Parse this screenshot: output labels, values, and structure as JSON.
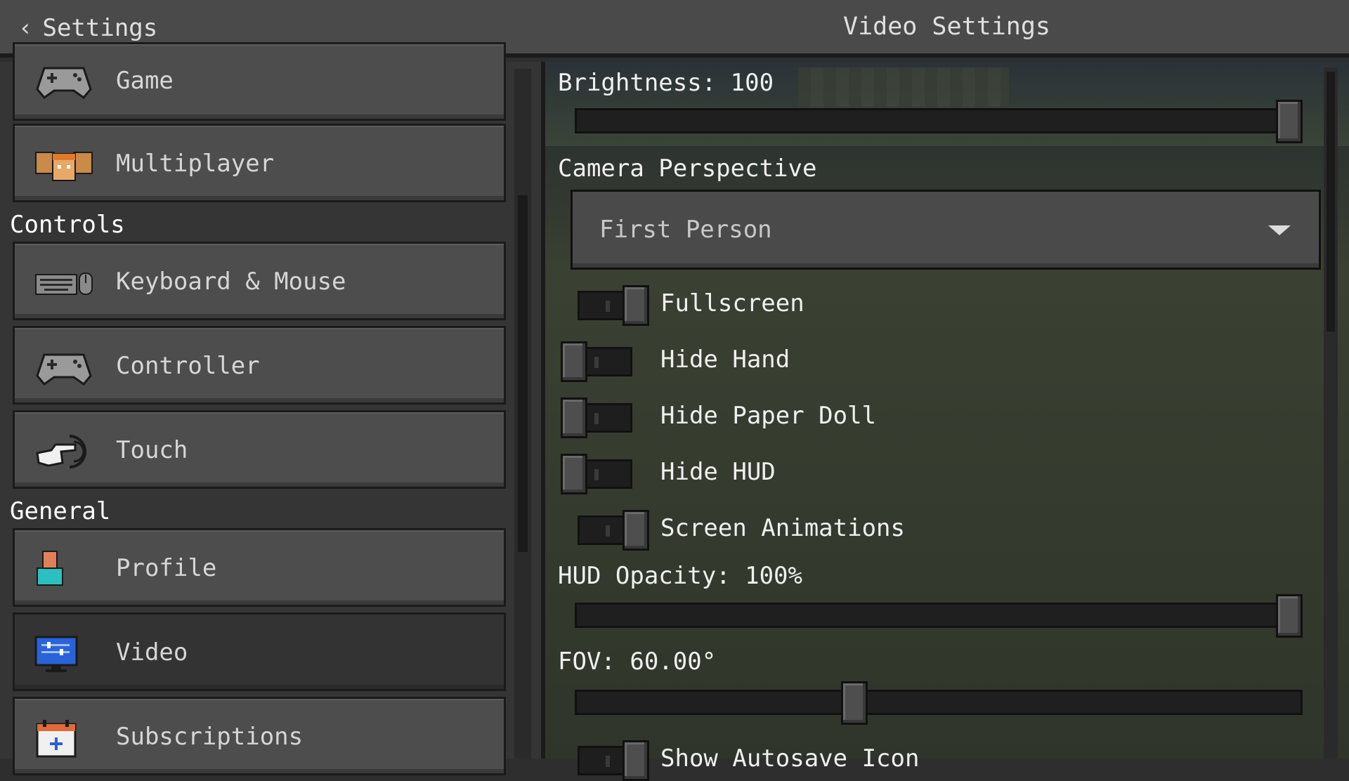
{
  "header": {
    "back_label": "Settings",
    "title": "Video Settings"
  },
  "sidebar": {
    "items_top": [
      {
        "label": "Game",
        "icon": "gamepad-icon"
      },
      {
        "label": "Multiplayer",
        "icon": "multiplayer-faces-icon"
      }
    ],
    "controls_heading": "Controls",
    "controls": [
      {
        "label": "Keyboard & Mouse",
        "icon": "keyboard-mouse-icon"
      },
      {
        "label": "Controller",
        "icon": "gamepad-icon"
      },
      {
        "label": "Touch",
        "icon": "touch-hand-icon"
      }
    ],
    "general_heading": "General",
    "general": [
      {
        "label": "Profile",
        "icon": "profile-icon"
      },
      {
        "label": "Video",
        "icon": "monitor-icon",
        "selected": true
      },
      {
        "label": "Subscriptions",
        "icon": "calendar-plus-icon"
      }
    ]
  },
  "video": {
    "brightness_label": "Brightness: 100",
    "brightness_value": 100,
    "camera_label": "Camera Perspective",
    "camera_value": "First Person",
    "toggles": [
      {
        "label": "Fullscreen",
        "on": true
      },
      {
        "label": "Hide Hand",
        "on": false
      },
      {
        "label": "Hide Paper Doll",
        "on": false
      },
      {
        "label": "Hide HUD",
        "on": false
      },
      {
        "label": "Screen Animations",
        "on": true
      }
    ],
    "hud_label": "HUD Opacity: 100%",
    "hud_value": 100,
    "fov_label": "FOV: 60.00°",
    "fov_fraction": 0.38,
    "autosave_label": "Show Autosave Icon"
  }
}
